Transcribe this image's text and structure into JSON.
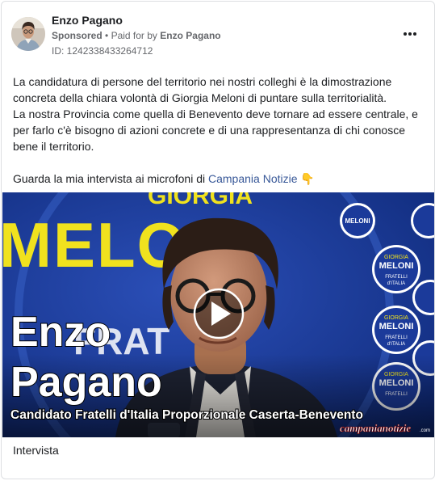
{
  "ad": {
    "page_name": "Enzo Pagano",
    "sponsored_label": "Sponsored",
    "separator": "•",
    "paid_for_prefix": "Paid for by",
    "paid_for_name": "Enzo Pagano",
    "id_text": "ID: 1242338433264712",
    "body_lines": [
      "La candidatura di persone del territorio nei nostri colleghi è la dimostrazione",
      "concreta della chiara volontà di Giorgia Meloni di puntare sulla territorialità.",
      "La nostra Provincia come quella di Benevento deve tornare ad essere centrale, e",
      "per farlo c'è bisogno di azioni concrete e di una rappresentanza di chi conosce",
      "bene il territorio."
    ],
    "cta_prefix": "Guarda la mia intervista ai microfoni di",
    "cta_link": "Campania Notizie",
    "cta_emoji": "👇",
    "caption": "Intervista"
  },
  "video": {
    "banner_top": "GIORGIA",
    "banner_main": "MELONI",
    "banner_frat": "FRAT",
    "logo_giorgia": "GIORGIA",
    "logo_meloni": "MELONI",
    "logo_fratelli": "FRATELLI",
    "logo_italia": "d'ITALIA",
    "overlay_first": "Enzo",
    "overlay_last": "Pagano",
    "overlay_subtitle": "Candidato Fratelli d'Italia Proporzionale Caserta-Benevento",
    "watermark_main": "campanianotizie",
    "watermark_tld": ".com"
  },
  "colors": {
    "link": "#385898",
    "banner_blue": "#1b3a9a",
    "banner_yellow": "#f0e21e",
    "text_secondary": "#65676b"
  }
}
